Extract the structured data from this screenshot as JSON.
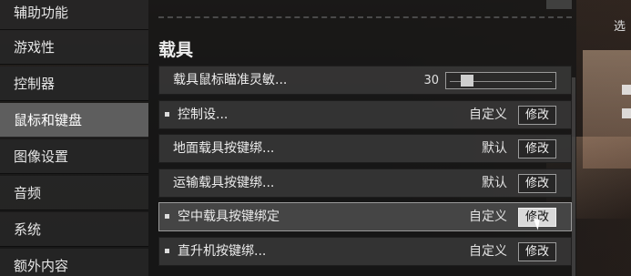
{
  "nav": {
    "items": [
      {
        "label": "辅助功能"
      },
      {
        "label": "游戏性"
      },
      {
        "label": "控制器"
      },
      {
        "label": "鼠标和键盘"
      },
      {
        "label": "图像设置"
      },
      {
        "label": "音频"
      },
      {
        "label": "系统"
      },
      {
        "label": "额外内容"
      }
    ],
    "selected": "鼠标和键盘"
  },
  "section": {
    "title": "载具"
  },
  "rows": [
    {
      "label": "载具鼠标瞄准灵敏...",
      "type": "slider",
      "value": "30",
      "slider_fraction": 0.12
    },
    {
      "label": "控制设...",
      "type": "choice",
      "value": "自定义",
      "button": "修改",
      "marked": true
    },
    {
      "label": "地面载具按键绑...",
      "type": "choice",
      "value": "默认",
      "button": "修改",
      "marked": false
    },
    {
      "label": "运输载具按键绑...",
      "type": "choice",
      "value": "默认",
      "button": "修改",
      "marked": false
    },
    {
      "label": "空中载具按键绑定",
      "type": "choice",
      "value": "自定义",
      "button": "修改",
      "marked": true,
      "highlighted": true
    },
    {
      "label": "直升机按键绑...",
      "type": "choice",
      "value": "自定义",
      "button": "修改",
      "marked": true
    }
  ],
  "right_hint": "选"
}
